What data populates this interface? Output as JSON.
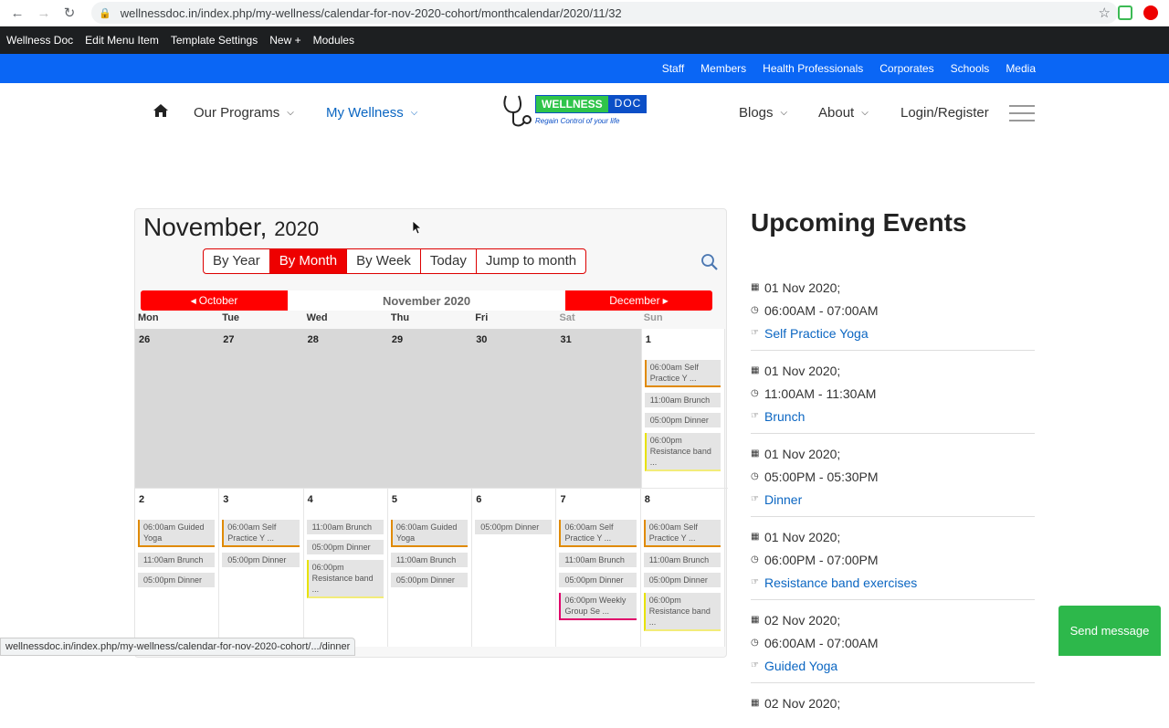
{
  "browser": {
    "url": "wellnessdoc.in/index.php/my-wellness/calendar-for-nov-2020-cohort/monthcalendar/2020/11/32"
  },
  "admin_bar": {
    "items": [
      "Wellness Doc",
      "Edit Menu Item",
      "Template Settings",
      "New +",
      "Modules"
    ]
  },
  "top_links": {
    "items": [
      "Staff",
      "Members",
      "Health Professionals",
      "Corporates",
      "Schools",
      "Media"
    ]
  },
  "main_nav": {
    "programs": "Our Programs",
    "my_wellness": "My Wellness",
    "blogs": "Blogs",
    "about": "About",
    "login": "Login/Register",
    "logo_word1": "WELLNESS",
    "logo_word2": "DOC",
    "logo_tagline": "Regain Control of your life"
  },
  "calendar": {
    "month": "November,",
    "year": "2020",
    "views": [
      "By Year",
      "By Month",
      "By Week",
      "Today",
      "Jump to month"
    ],
    "prev_month": "October",
    "current_month": "November 2020",
    "next_month": "December",
    "days_of_week": [
      "Mon",
      "Tue",
      "Wed",
      "Thu",
      "Fri",
      "Sat",
      "Sun"
    ],
    "week1": {
      "days": [
        "26",
        "27",
        "28",
        "29",
        "30",
        "31",
        "1"
      ],
      "sun_events": [
        "06:00am Self Practice Y ...",
        "11:00am Brunch",
        "05:00pm Dinner",
        "06:00pm Resistance band ..."
      ]
    },
    "week2": {
      "days": [
        "2",
        "3",
        "4",
        "5",
        "6",
        "7",
        "8"
      ],
      "mon": [
        "06:00am Guided Yoga",
        "11:00am Brunch",
        "05:00pm Dinner"
      ],
      "tue": [
        "06:00am Self Practice Y ...",
        "05:00pm Dinner"
      ],
      "wed": [
        "11:00am Brunch",
        "05:00pm Dinner",
        "06:00pm Resistance band ..."
      ],
      "thu": [
        "06:00am Guided Yoga",
        "11:00am Brunch",
        "05:00pm Dinner"
      ],
      "fri": [
        "05:00pm Dinner"
      ],
      "sat": [
        "06:00am Self Practice Y ...",
        "11:00am Brunch",
        "05:00pm Dinner",
        "06:00pm Weekly Group Se ..."
      ],
      "sun": [
        "06:00am Self Practice Y ...",
        "11:00am Brunch",
        "05:00pm Dinner",
        "06:00pm Resistance band ..."
      ]
    }
  },
  "upcoming": {
    "title": "Upcoming Events",
    "events": [
      {
        "date": "01 Nov 2020",
        "time_start": "06:00AM",
        "time_end": "07:00AM",
        "name": "Self Practice Yoga"
      },
      {
        "date": "01 Nov 2020",
        "time_start": "11:00AM",
        "time_end": "11:30AM",
        "name": "Brunch"
      },
      {
        "date": "01 Nov 2020",
        "time_start": "05:00PM",
        "time_end": "05:30PM",
        "name": "Dinner"
      },
      {
        "date": "01 Nov 2020",
        "time_start": "06:00PM",
        "time_end": "07:00PM",
        "name": "Resistance band exercises"
      },
      {
        "date": "02 Nov 2020",
        "time_start": "06:00AM",
        "time_end": "07:00AM",
        "name": "Guided Yoga"
      },
      {
        "date": "02 Nov 2020"
      }
    ]
  },
  "send_message": "Send message",
  "status_bar_url": "wellnessdoc.in/index.php/my-wellness/calendar-for-nov-2020-cohort/.../dinner"
}
